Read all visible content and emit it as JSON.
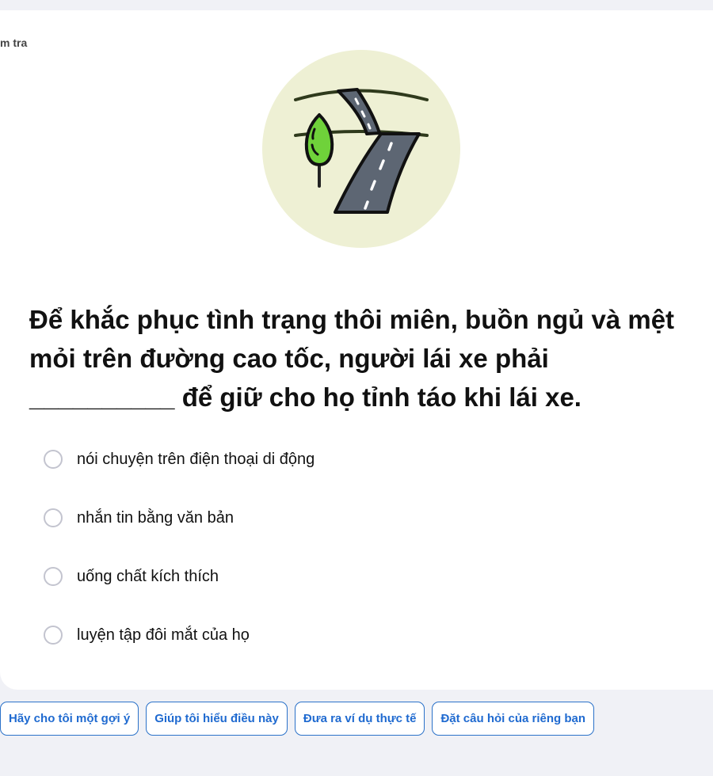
{
  "header": {
    "breadcrumb": "m tra"
  },
  "illustration": {
    "icon": "winding-road-icon",
    "bg_color": "#eef0d4"
  },
  "question": {
    "text": "Để khắc phục tình trạng thôi miên, buồn ngủ và mệt mỏi trên đường cao tốc, người lái xe phải __________ để giữ cho họ tỉnh táo khi lái xe."
  },
  "options": [
    {
      "label": "nói chuyện trên điện thoại di động"
    },
    {
      "label": "nhắn tin bằng văn bản"
    },
    {
      "label": "uống chất kích thích"
    },
    {
      "label": "luyện tập đôi mắt của họ"
    }
  ],
  "help_chips": [
    {
      "label": "Hãy cho tôi một gợi ý"
    },
    {
      "label": "Giúp tôi hiểu điều này"
    },
    {
      "label": "Đưa ra ví dụ thực tế"
    },
    {
      "label": "Đặt câu hỏi của riêng bạn"
    }
  ],
  "colors": {
    "accent": "#1f6ad0",
    "radio_border": "#c3c4cf",
    "page_bg": "#f0f1f6"
  }
}
